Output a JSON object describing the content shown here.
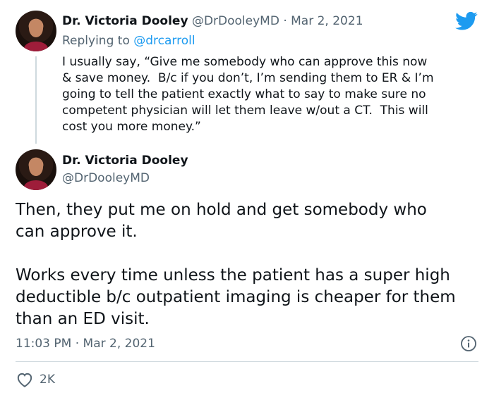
{
  "reply_tweet": {
    "author_name": "Dr. Victoria Dooley",
    "author_handle": "@DrDooleyMD",
    "separator": " · ",
    "date": "Mar 2, 2021",
    "replying_prefix": "Replying to ",
    "replying_handle": "@drcarroll",
    "text": "I usually say, “Give me somebody who can approve this now\n& save money.  B/c if you don’t, I’m sending them to ER & I’m\ngoing to tell the patient exactly what to say to make sure no\ncompetent physician will let them leave w/out a CT.  This will\ncost you more money.”"
  },
  "main_tweet": {
    "author_name": "Dr. Victoria Dooley",
    "author_handle": "@DrDooleyMD",
    "text": "Then, they put me on hold and get somebody who\ncan approve it.\n\nWorks every time unless the patient has a super high\ndeductible b/c outpatient imaging is cheaper for them\nthan an ED visit.",
    "timestamp": "11:03 PM · Mar 2, 2021",
    "like_count": "2K"
  },
  "colors": {
    "accent": "#1d9bf0",
    "text": "#0f1419",
    "muted": "#536471",
    "divider": "#cfd9de"
  },
  "icons": {
    "brand": "twitter-bird-icon",
    "info": "info-icon",
    "like": "heart-icon"
  }
}
